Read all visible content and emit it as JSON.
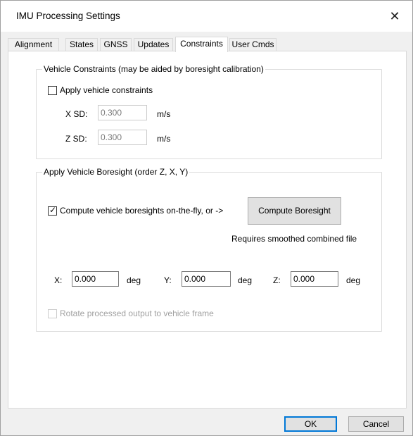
{
  "window": {
    "title": "IMU Processing Settings",
    "close_glyph": "✕"
  },
  "tabs": [
    {
      "label": "Alignment"
    },
    {
      "label": "States"
    },
    {
      "label": "GNSS"
    },
    {
      "label": "Updates"
    },
    {
      "label": "Constraints",
      "active": true
    },
    {
      "label": "User Cmds"
    }
  ],
  "vehicle_constraints": {
    "title": "Vehicle Constraints (may be aided by boresight calibration)",
    "apply_label": "Apply vehicle constraints",
    "apply_checked": false,
    "xsd_label": "X SD:",
    "xsd_value": "0.300",
    "xsd_unit": "m/s",
    "zsd_label": "Z SD:",
    "zsd_value": "0.300",
    "zsd_unit": "m/s"
  },
  "boresight": {
    "title": "Apply Vehicle Boresight (order Z, X, Y)",
    "compute_label": "Compute vehicle boresights on-the-fly, or ->",
    "compute_checked": true,
    "compute_button": "Compute Boresight",
    "requires_note": "Requires smoothed combined file",
    "x_label": "X:",
    "x_value": "0.000",
    "x_unit": "deg",
    "y_label": "Y:",
    "y_value": "0.000",
    "y_unit": "deg",
    "z_label": "Z:",
    "z_value": "0.000",
    "z_unit": "deg",
    "rotate_label": "Rotate processed output to vehicle frame",
    "rotate_checked": false
  },
  "footer": {
    "ok_label": "OK",
    "cancel_label": "Cancel"
  },
  "colors": {
    "accent": "#0078d7",
    "disabled_text": "#a0a0a0"
  }
}
